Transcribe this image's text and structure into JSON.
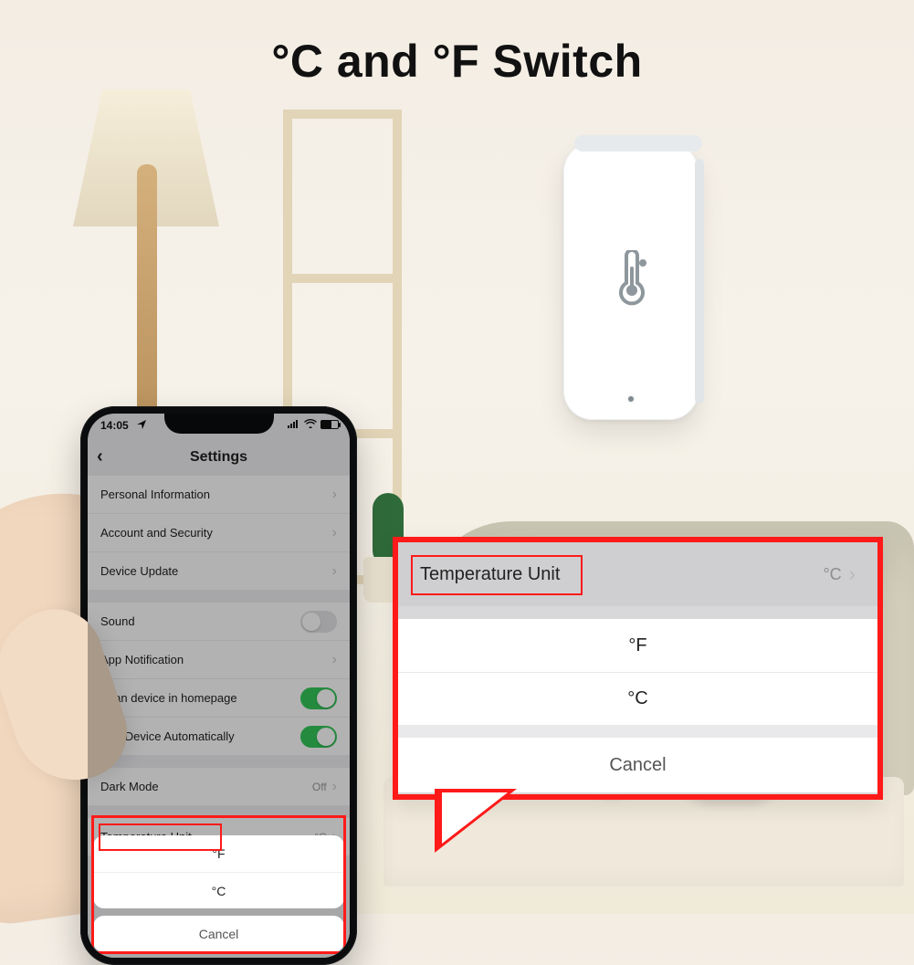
{
  "headline": "°C and °F Switch",
  "statusbar": {
    "time": "14:05"
  },
  "nav": {
    "title": "Settings",
    "back_glyph": "‹"
  },
  "settings": {
    "rows": [
      {
        "label": "Personal Information",
        "type": "chevron"
      },
      {
        "label": "Account and Security",
        "type": "chevron"
      },
      {
        "label": "Device Update",
        "type": "chevron"
      },
      {
        "label": "Sound",
        "type": "toggle",
        "on": false,
        "gap": true
      },
      {
        "label": "App Notification",
        "type": "chevron"
      },
      {
        "label": "Scan device in homepage",
        "type": "toggle",
        "on": true
      },
      {
        "label": "Add Device Automatically",
        "type": "toggle",
        "on": true
      },
      {
        "label": "Dark Mode",
        "type": "value",
        "value": "Off",
        "gap": true
      },
      {
        "label": "Temperature Unit",
        "type": "value",
        "value": "°C",
        "gap": true
      }
    ]
  },
  "sheet": {
    "options": [
      "°F",
      "°C"
    ],
    "cancel": "Cancel"
  },
  "callout": {
    "row_label": "Temperature Unit",
    "row_value": "°C",
    "options": [
      "°F",
      "°C"
    ],
    "cancel": "Cancel"
  }
}
